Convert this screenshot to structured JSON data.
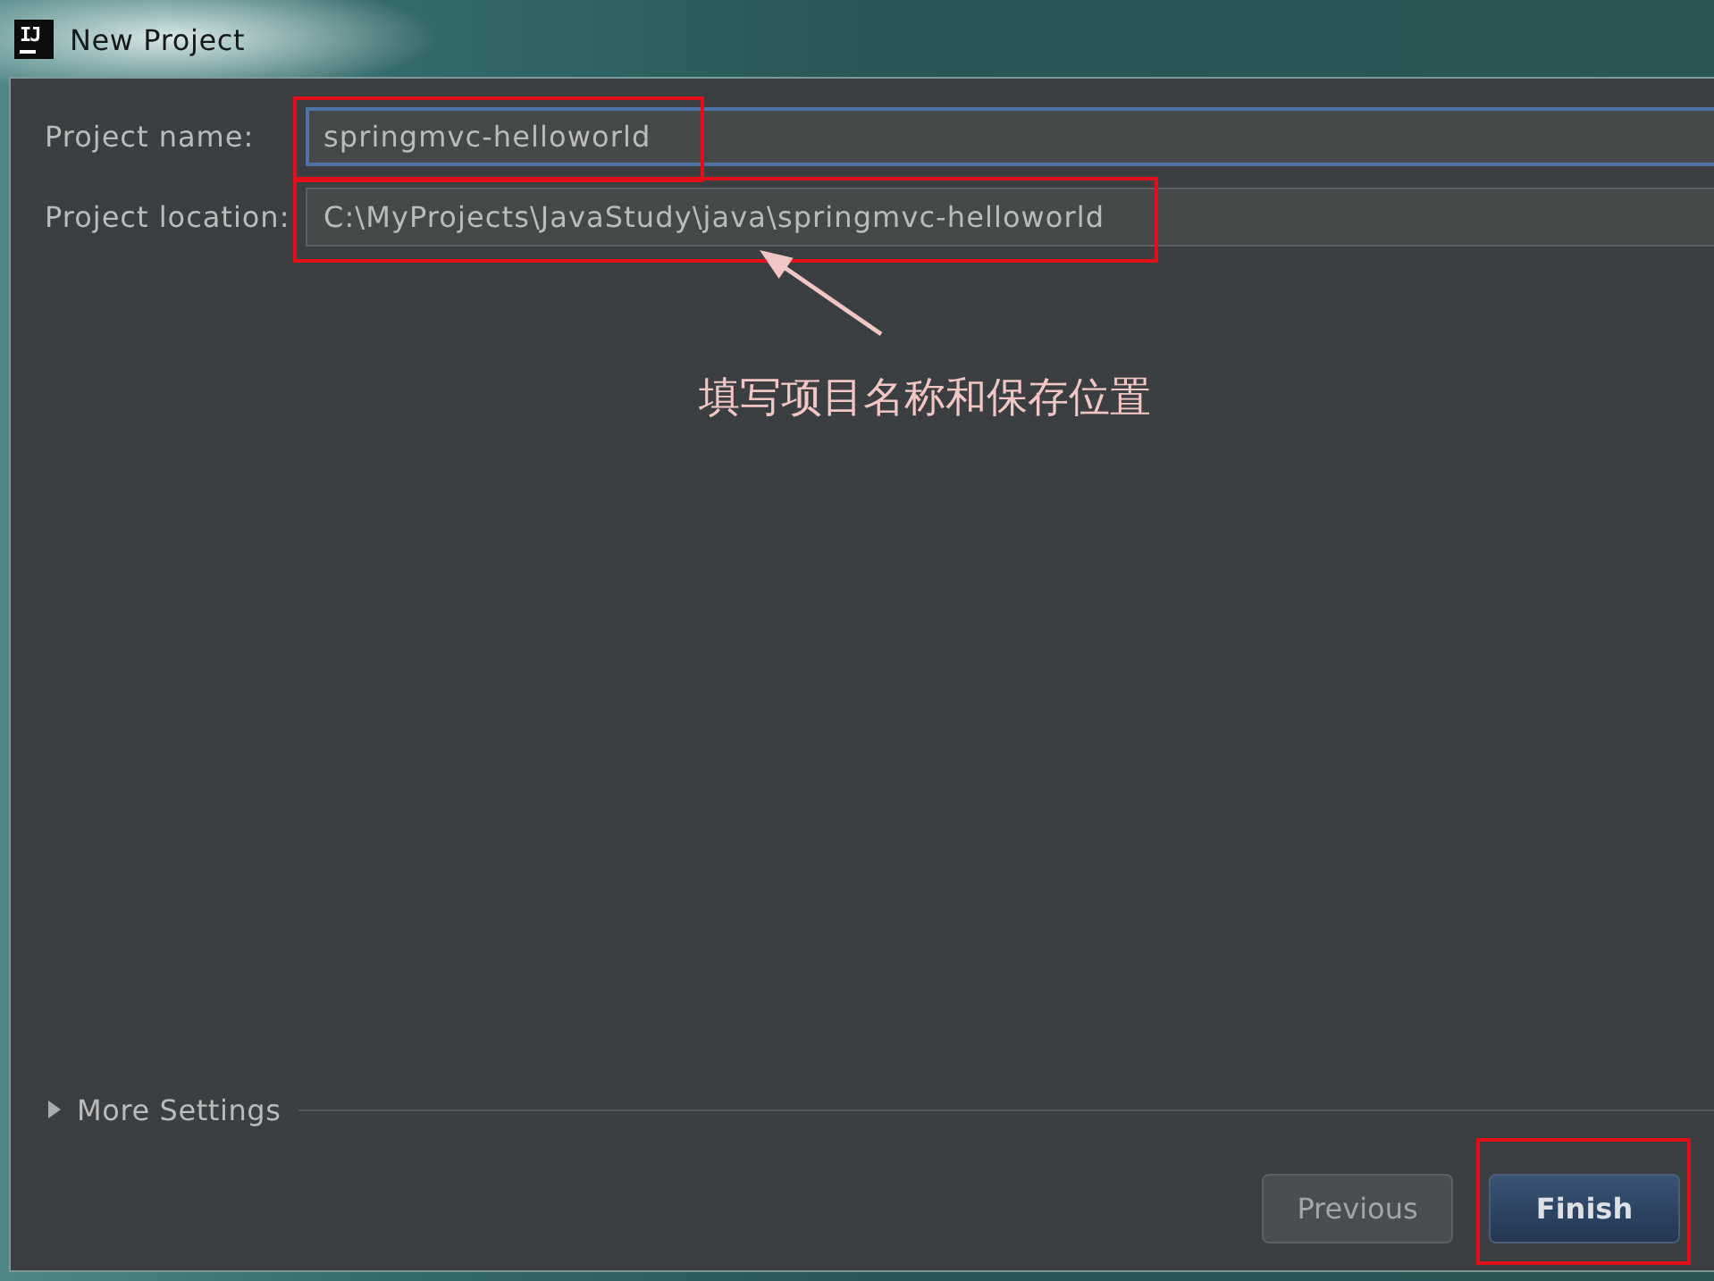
{
  "window": {
    "icon_text": "IJ",
    "title": "New Project"
  },
  "fields": [
    {
      "label": "Project name:",
      "value": "springmvc-helloworld",
      "focused": true,
      "highlighted": true
    },
    {
      "label": "Project location:",
      "value": "C:\\MyProjects\\JavaStudy\\java\\springmvc-helloworld",
      "focused": false,
      "highlighted": true
    }
  ],
  "callout": {
    "text": "填写项目名称和保存位置"
  },
  "more_settings": {
    "label": "More Settings",
    "expanded": false
  },
  "buttons": [
    {
      "label": "Previous",
      "kind": "secondary",
      "highlighted": false
    },
    {
      "label": "Finish",
      "kind": "default",
      "highlighted": true
    }
  ]
}
